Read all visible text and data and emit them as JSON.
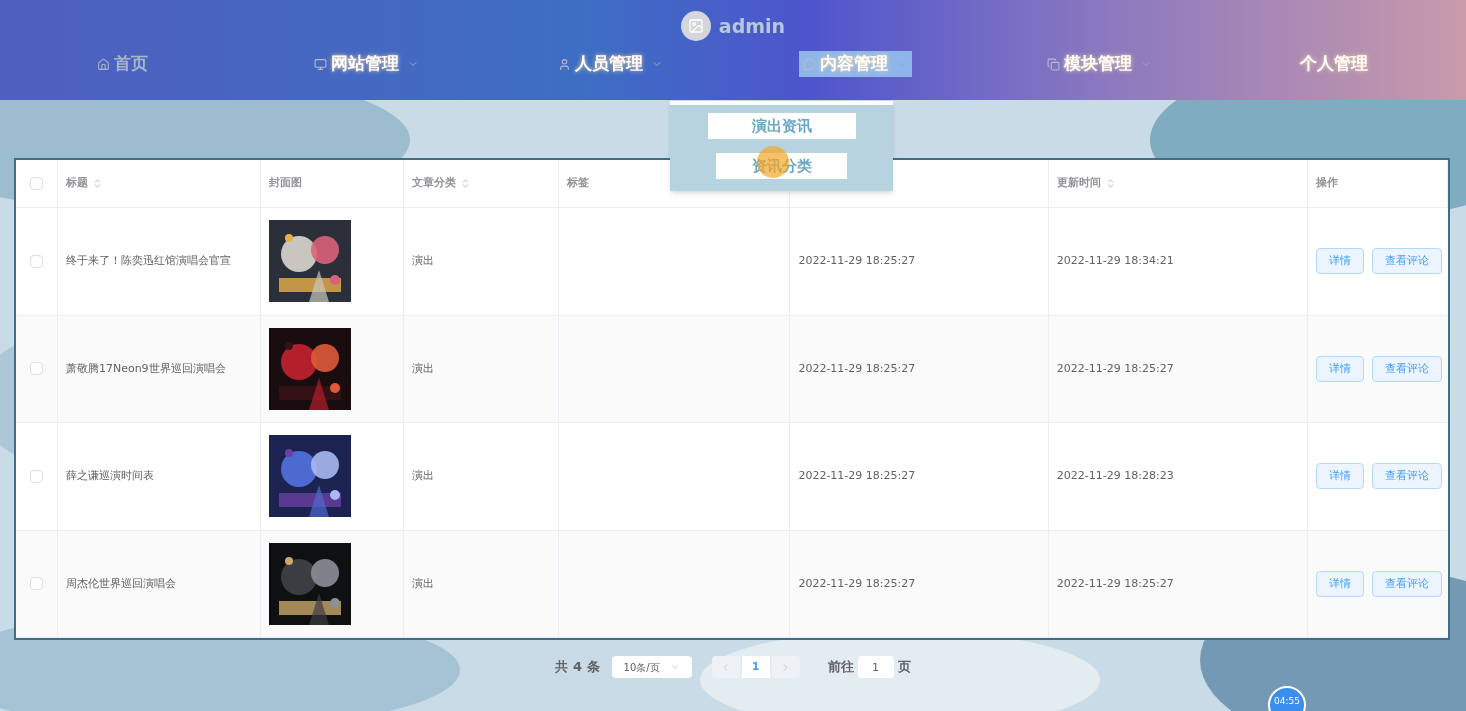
{
  "header": {
    "username": "admin"
  },
  "nav": [
    {
      "label": "首页",
      "caret": false,
      "selected": false,
      "dim": true
    },
    {
      "label": "网站管理",
      "caret": true,
      "selected": false,
      "dim": false
    },
    {
      "label": "人员管理",
      "caret": true,
      "selected": false,
      "dim": false
    },
    {
      "label": "内容管理",
      "caret": true,
      "selected": true,
      "dim": false
    },
    {
      "label": "模块管理",
      "caret": true,
      "selected": false,
      "dim": false
    },
    {
      "label": "个人管理",
      "caret": true,
      "selected": false,
      "dim": false
    }
  ],
  "dropdown": {
    "items": [
      "演出资讯",
      "资讯分类"
    ]
  },
  "table": {
    "select_all_checked": false,
    "columns": [
      {
        "label": "标题",
        "sortable": true
      },
      {
        "label": "封面图",
        "sortable": false
      },
      {
        "label": "文章分类",
        "sortable": true
      },
      {
        "label": "标签",
        "sortable": false
      },
      {
        "label": "更新时间",
        "sortable": true
      },
      {
        "label": "操作",
        "sortable": false
      }
    ],
    "rows": [
      {
        "title": "终于来了！陈奕迅红馆演唱会官宣",
        "category": "演出",
        "created": "2022-11-29 18:25:27",
        "updated": "2022-11-29 18:34:21",
        "checked": false,
        "actions": [
          "详情",
          "查看评论"
        ]
      },
      {
        "title": "萧敬腾17Neon9世界巡回演唱会",
        "category": "演出",
        "created": "2022-11-29 18:25:27",
        "updated": "2022-11-29 18:25:27",
        "checked": false,
        "actions": [
          "详情",
          "查看评论"
        ]
      },
      {
        "title": "薛之谦巡演时间表",
        "category": "演出",
        "created": "2022-11-29 18:25:27",
        "updated": "2022-11-29 18:28:23",
        "checked": false,
        "actions": [
          "详情",
          "查看评论"
        ]
      },
      {
        "title": "周杰伦世界巡回演唱会",
        "category": "演出",
        "created": "2022-11-29 18:25:27",
        "updated": "2022-11-29 18:25:27",
        "checked": false,
        "actions": [
          "详情",
          "查看评论"
        ]
      }
    ]
  },
  "pagination": {
    "total": "共 4 条",
    "page_size": "10条/页",
    "pages": [
      {
        "label": "1",
        "selected": true
      }
    ],
    "goto_label": "前往",
    "goto_value": "1",
    "goto_suffix": "页"
  },
  "timer": "04:55"
}
